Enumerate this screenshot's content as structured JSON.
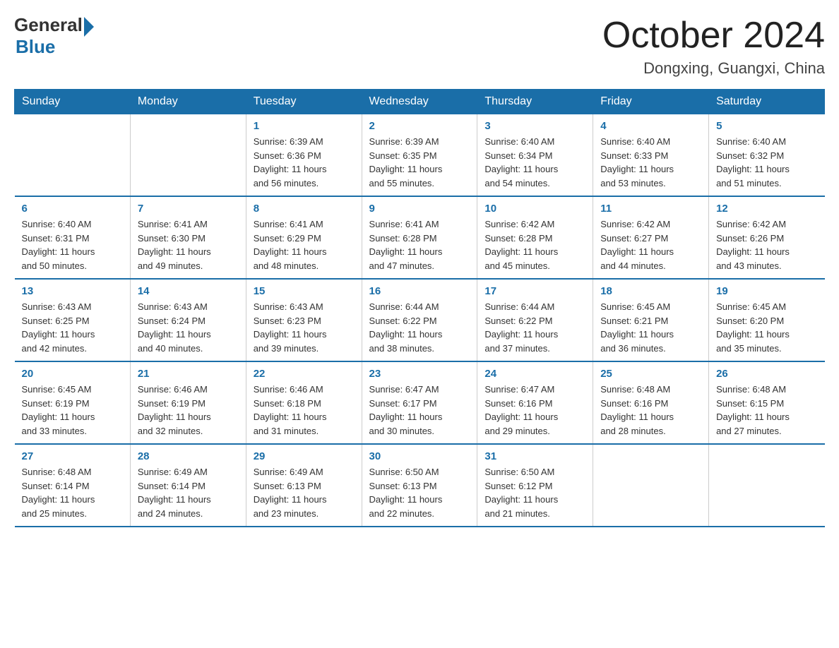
{
  "logo": {
    "general": "General",
    "blue": "Blue",
    "arrow": "▶"
  },
  "header": {
    "month": "October 2024",
    "location": "Dongxing, Guangxi, China"
  },
  "weekdays": [
    "Sunday",
    "Monday",
    "Tuesday",
    "Wednesday",
    "Thursday",
    "Friday",
    "Saturday"
  ],
  "weeks": [
    [
      {
        "day": "",
        "info": ""
      },
      {
        "day": "",
        "info": ""
      },
      {
        "day": "1",
        "info": "Sunrise: 6:39 AM\nSunset: 6:36 PM\nDaylight: 11 hours\nand 56 minutes."
      },
      {
        "day": "2",
        "info": "Sunrise: 6:39 AM\nSunset: 6:35 PM\nDaylight: 11 hours\nand 55 minutes."
      },
      {
        "day": "3",
        "info": "Sunrise: 6:40 AM\nSunset: 6:34 PM\nDaylight: 11 hours\nand 54 minutes."
      },
      {
        "day": "4",
        "info": "Sunrise: 6:40 AM\nSunset: 6:33 PM\nDaylight: 11 hours\nand 53 minutes."
      },
      {
        "day": "5",
        "info": "Sunrise: 6:40 AM\nSunset: 6:32 PM\nDaylight: 11 hours\nand 51 minutes."
      }
    ],
    [
      {
        "day": "6",
        "info": "Sunrise: 6:40 AM\nSunset: 6:31 PM\nDaylight: 11 hours\nand 50 minutes."
      },
      {
        "day": "7",
        "info": "Sunrise: 6:41 AM\nSunset: 6:30 PM\nDaylight: 11 hours\nand 49 minutes."
      },
      {
        "day": "8",
        "info": "Sunrise: 6:41 AM\nSunset: 6:29 PM\nDaylight: 11 hours\nand 48 minutes."
      },
      {
        "day": "9",
        "info": "Sunrise: 6:41 AM\nSunset: 6:28 PM\nDaylight: 11 hours\nand 47 minutes."
      },
      {
        "day": "10",
        "info": "Sunrise: 6:42 AM\nSunset: 6:28 PM\nDaylight: 11 hours\nand 45 minutes."
      },
      {
        "day": "11",
        "info": "Sunrise: 6:42 AM\nSunset: 6:27 PM\nDaylight: 11 hours\nand 44 minutes."
      },
      {
        "day": "12",
        "info": "Sunrise: 6:42 AM\nSunset: 6:26 PM\nDaylight: 11 hours\nand 43 minutes."
      }
    ],
    [
      {
        "day": "13",
        "info": "Sunrise: 6:43 AM\nSunset: 6:25 PM\nDaylight: 11 hours\nand 42 minutes."
      },
      {
        "day": "14",
        "info": "Sunrise: 6:43 AM\nSunset: 6:24 PM\nDaylight: 11 hours\nand 40 minutes."
      },
      {
        "day": "15",
        "info": "Sunrise: 6:43 AM\nSunset: 6:23 PM\nDaylight: 11 hours\nand 39 minutes."
      },
      {
        "day": "16",
        "info": "Sunrise: 6:44 AM\nSunset: 6:22 PM\nDaylight: 11 hours\nand 38 minutes."
      },
      {
        "day": "17",
        "info": "Sunrise: 6:44 AM\nSunset: 6:22 PM\nDaylight: 11 hours\nand 37 minutes."
      },
      {
        "day": "18",
        "info": "Sunrise: 6:45 AM\nSunset: 6:21 PM\nDaylight: 11 hours\nand 36 minutes."
      },
      {
        "day": "19",
        "info": "Sunrise: 6:45 AM\nSunset: 6:20 PM\nDaylight: 11 hours\nand 35 minutes."
      }
    ],
    [
      {
        "day": "20",
        "info": "Sunrise: 6:45 AM\nSunset: 6:19 PM\nDaylight: 11 hours\nand 33 minutes."
      },
      {
        "day": "21",
        "info": "Sunrise: 6:46 AM\nSunset: 6:19 PM\nDaylight: 11 hours\nand 32 minutes."
      },
      {
        "day": "22",
        "info": "Sunrise: 6:46 AM\nSunset: 6:18 PM\nDaylight: 11 hours\nand 31 minutes."
      },
      {
        "day": "23",
        "info": "Sunrise: 6:47 AM\nSunset: 6:17 PM\nDaylight: 11 hours\nand 30 minutes."
      },
      {
        "day": "24",
        "info": "Sunrise: 6:47 AM\nSunset: 6:16 PM\nDaylight: 11 hours\nand 29 minutes."
      },
      {
        "day": "25",
        "info": "Sunrise: 6:48 AM\nSunset: 6:16 PM\nDaylight: 11 hours\nand 28 minutes."
      },
      {
        "day": "26",
        "info": "Sunrise: 6:48 AM\nSunset: 6:15 PM\nDaylight: 11 hours\nand 27 minutes."
      }
    ],
    [
      {
        "day": "27",
        "info": "Sunrise: 6:48 AM\nSunset: 6:14 PM\nDaylight: 11 hours\nand 25 minutes."
      },
      {
        "day": "28",
        "info": "Sunrise: 6:49 AM\nSunset: 6:14 PM\nDaylight: 11 hours\nand 24 minutes."
      },
      {
        "day": "29",
        "info": "Sunrise: 6:49 AM\nSunset: 6:13 PM\nDaylight: 11 hours\nand 23 minutes."
      },
      {
        "day": "30",
        "info": "Sunrise: 6:50 AM\nSunset: 6:13 PM\nDaylight: 11 hours\nand 22 minutes."
      },
      {
        "day": "31",
        "info": "Sunrise: 6:50 AM\nSunset: 6:12 PM\nDaylight: 11 hours\nand 21 minutes."
      },
      {
        "day": "",
        "info": ""
      },
      {
        "day": "",
        "info": ""
      }
    ]
  ]
}
